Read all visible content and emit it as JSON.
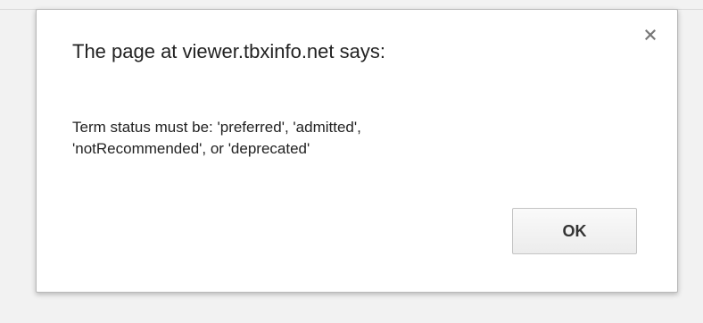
{
  "dialog": {
    "title": "The page at viewer.tbxinfo.net says:",
    "message_line_1": "Term status must be: 'preferred', 'admitted',",
    "message_line_2": "'notRecommended', or 'deprecated'",
    "ok_label": "OK",
    "close_icon": "close-icon"
  },
  "colors": {
    "backdrop": "#f2f2f2",
    "dialog_background": "#ffffff",
    "text": "#222222",
    "close_icon": "#777777"
  }
}
